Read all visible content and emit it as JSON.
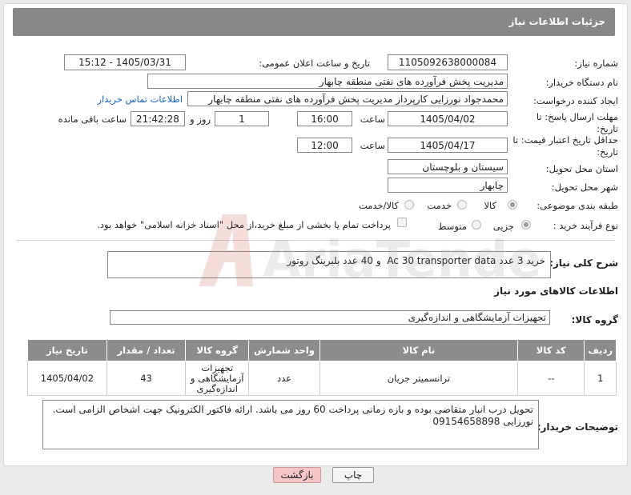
{
  "header": {
    "title": "جزئیات اطلاعات نیاز"
  },
  "need_number": {
    "label": "شماره نیاز:",
    "value": "1105092638000084"
  },
  "announce_datetime": {
    "label": "تاریخ و ساعت اعلان عمومی:",
    "value": "1405/03/31 - 15:12"
  },
  "buyer_org": {
    "label": "نام دستگاه خریدار:",
    "value": "مدیریت پخش فرآورده های نفتی منطقه چابهار"
  },
  "requester": {
    "label": "ایجاد کننده درخواست:",
    "value": "محمدجواد نورزایی کارپرداز مدیریت پخش فرآورده های نفتی منطقه چابهار",
    "contact_link": "اطلاعات تماس خریدار"
  },
  "reply_deadline": {
    "label": "مهلت ارسال پاسخ: تا تاریخ:",
    "date": "1405/04/02",
    "time_label": "ساعت",
    "time": "16:00",
    "days": "1",
    "days_label": "روز و",
    "remaining": "21:42:28",
    "remaining_label": "ساعت باقی مانده"
  },
  "price_validity": {
    "label": "حداقل تاریخ اعتبار قیمت: تا تاریخ:",
    "date": "1405/04/17",
    "time_label": "ساعت",
    "time": "12:00"
  },
  "delivery_province": {
    "label": "استان محل تحویل:",
    "value": "سیستان و بلوچستان"
  },
  "delivery_city": {
    "label": "شهر محل تحویل:",
    "value": "چابهار"
  },
  "category": {
    "label": "طبقه بندی موضوعی:",
    "options": [
      "کالا",
      "خدمت",
      "کالا/خدمت"
    ],
    "selected": "کالا"
  },
  "purchase_process": {
    "label": "نوع فرآیند خرید :",
    "options": [
      "جزیی",
      "متوسط"
    ],
    "selected": "جزیی",
    "payment_note": "پرداخت تمام یا بخشی از مبلغ خرید،از محل \"اسناد خزانه اسلامی\" خواهد بود."
  },
  "description": {
    "label": "شرح کلی نیاز:",
    "value": "خرید 3 عدد Ac 30 transporter data  و 40 عدد بلبرینگ روتور"
  },
  "goods_info": {
    "title": "اطلاعات کالاهای مورد نیاز"
  },
  "goods_group": {
    "label": "گروه کالا:",
    "value": "تجهیزات آزمایشگاهی و اندازه‌گیری"
  },
  "goods_table": {
    "headers": [
      "ردیف",
      "کد کالا",
      "نام کالا",
      "واحد شمارش",
      "گروه کالا",
      "تعداد / مقدار",
      "تاریخ نیاز"
    ],
    "rows": [
      [
        "1",
        "--",
        "ترانسمیتر جریان",
        "عدد",
        "تجهیزات آزمایشگاهی و اندازه‌گیری",
        "43",
        "1405/04/02"
      ]
    ]
  },
  "buyer_notes": {
    "label": "توضیحات خریدار:",
    "value": "تحویل درب انبار متقاضی بوده و بازه زمانی پرداخت 60 روز می باشد. ارائه فاکتور الکترونیک جهت اشخاص الزامی است.\nنورزایی 09154658898"
  },
  "buttons": {
    "print": "چاپ",
    "back": "بازگشت"
  },
  "watermark": {
    "text": "AriaTender.net"
  },
  "colors": {
    "header_bg": "#888888",
    "link": "#1a63c9",
    "back_button": "#f5c6c6"
  }
}
